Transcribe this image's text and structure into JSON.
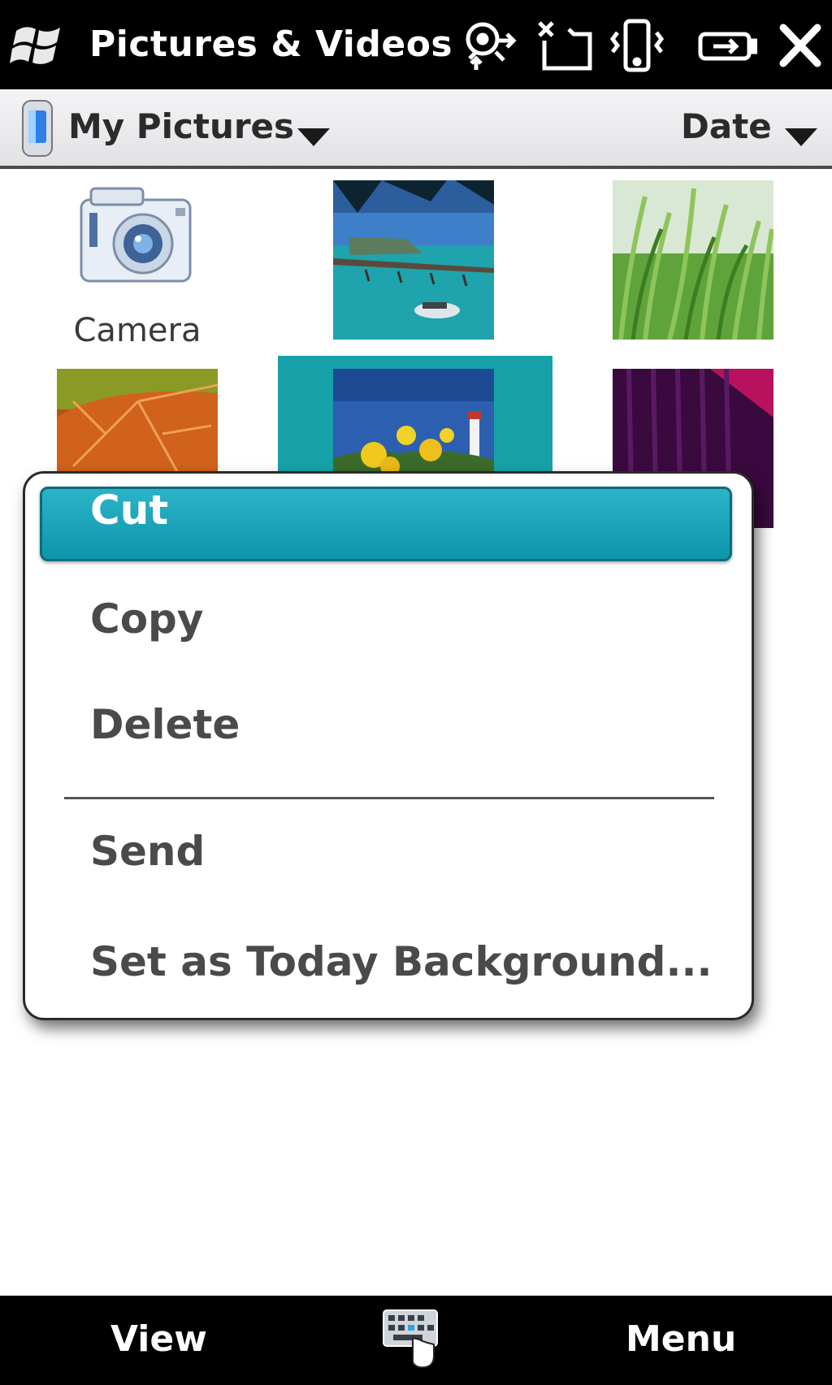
{
  "titlebar": {
    "title": "Pictures & Videos",
    "icons": [
      "windows-logo-icon",
      "connectivity-icon",
      "signal-off-icon",
      "vibrate-icon",
      "battery-icon",
      "close-icon"
    ]
  },
  "folderbar": {
    "folder": "My Pictures",
    "sort": "Date"
  },
  "grid": {
    "items": [
      {
        "type": "folder",
        "label": "Camera",
        "icon": "camera-icon"
      },
      {
        "type": "picture",
        "subject": "pier-ocean"
      },
      {
        "type": "picture",
        "subject": "grass"
      },
      {
        "type": "picture",
        "subject": "autumn-leaf"
      },
      {
        "type": "picture",
        "subject": "yellow-flowers-lighthouse",
        "selected": true
      },
      {
        "type": "picture",
        "subject": "purple-abstract"
      }
    ]
  },
  "context_menu": {
    "items": [
      {
        "label": "Cut",
        "highlighted": true
      },
      {
        "label": "Copy"
      },
      {
        "label": "Delete"
      },
      {
        "label": "Send"
      },
      {
        "label": "Set as Today Background..."
      }
    ]
  },
  "softkeys": {
    "left": "View",
    "right": "Menu"
  },
  "colors": {
    "highlight": "#16a2a8",
    "bar_background": "#000000"
  }
}
